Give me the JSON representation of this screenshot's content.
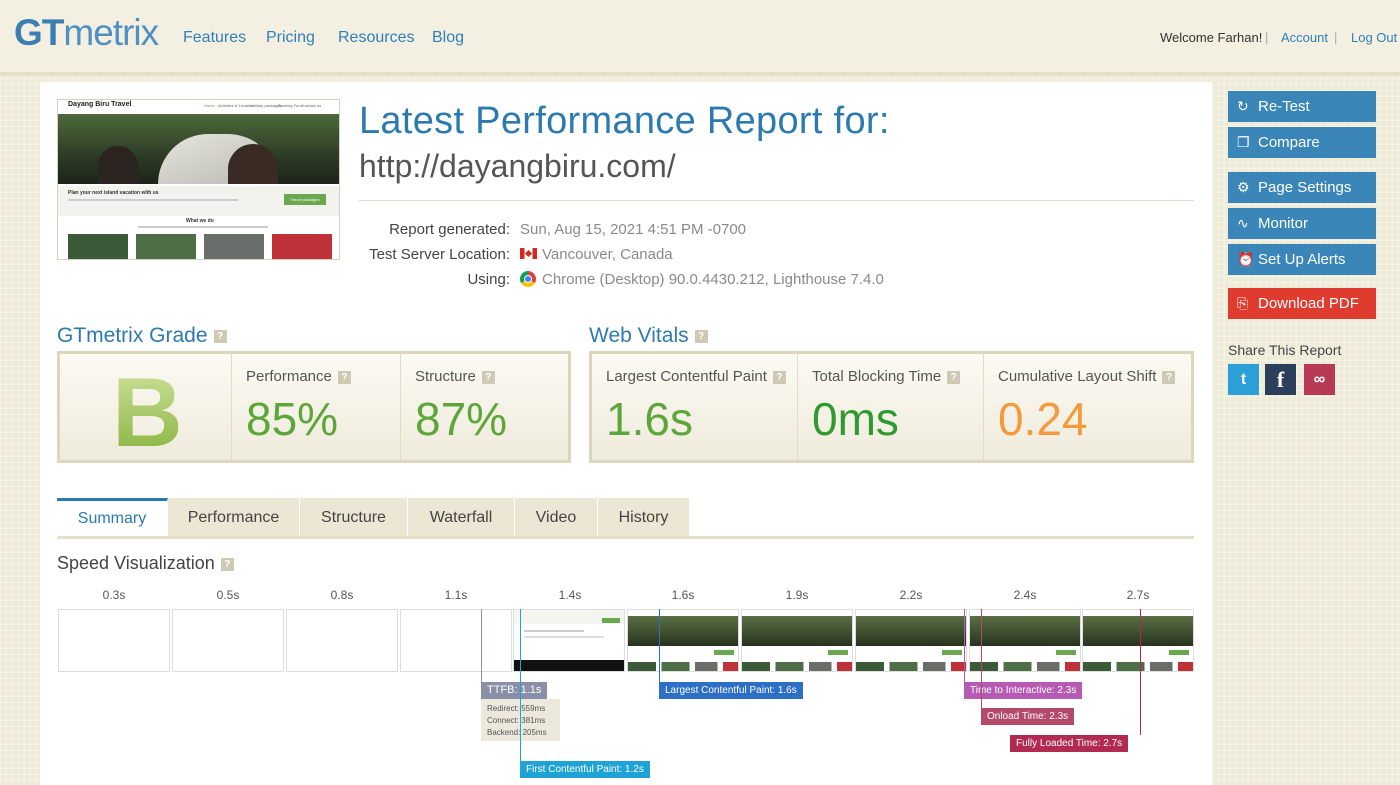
{
  "header": {
    "logo_gt": "GT",
    "logo_metrix": "metrix",
    "nav": [
      "Features",
      "Pricing",
      "Resources",
      "Blog"
    ],
    "welcome": "Welcome Farhan!",
    "account": "Account",
    "logout": "Log Out"
  },
  "report": {
    "title": "Latest Performance Report for:",
    "url": "http://dayangbiru.com/",
    "generated_label": "Report generated:",
    "generated_value": "Sun, Aug 15, 2021 4:51 PM -0700",
    "server_label": "Test Server Location:",
    "server_value": "Vancouver, Canada",
    "using_label": "Using:",
    "using_value": "Chrome (Desktop) 90.0.4430.212, Lighthouse 7.4.0"
  },
  "thumb": {
    "site_title": "Dayang Biru Travel",
    "menu": [
      "Home",
      "Activities & Location",
      "Holiday packages",
      "Booking Form",
      "Contact us"
    ],
    "banner": "Plan your next island vacation with us",
    "cta": "Travel packages",
    "what": "What we do"
  },
  "grade": {
    "title": "GTmetrix Grade",
    "letter": "B",
    "perf_label": "Performance",
    "perf_value": "85%",
    "struct_label": "Structure",
    "struct_value": "87%"
  },
  "vitals": {
    "title": "Web Vitals",
    "lcp_label": "Largest Contentful Paint",
    "lcp_value": "1.6s",
    "tbt_label": "Total Blocking Time",
    "tbt_value": "0ms",
    "cls_label": "Cumulative Layout Shift",
    "cls_value": "0.24"
  },
  "tabs": [
    "Summary",
    "Performance",
    "Structure",
    "Waterfall",
    "Video",
    "History"
  ],
  "speed": {
    "title": "Speed Visualization",
    "times": [
      "0.3s",
      "0.5s",
      "0.8s",
      "1.1s",
      "1.4s",
      "1.6s",
      "1.9s",
      "2.2s",
      "2.4s",
      "2.7s"
    ],
    "ttfb": "TTFB: 1.1s",
    "redirect": "Redirect: 559ms",
    "connect": "Connect: 381ms",
    "backend": "Backend: 205ms",
    "fcp": "First Contentful Paint: 1.2s",
    "lcp": "Largest Contentful Paint: 1.6s",
    "tti": "Time to Interactive: 2.3s",
    "onload": "Onload Time: 2.3s",
    "fully": "Fully Loaded Time: 2.7s"
  },
  "sidebar": {
    "retest": "Re-Test",
    "compare": "Compare",
    "settings": "Page Settings",
    "monitor": "Monitor",
    "alerts": "Set Up Alerts",
    "pdf": "Download PDF",
    "share": "Share This Report"
  },
  "colors": {
    "accent": "#2c7ab0",
    "grade": "#8fbe4a",
    "green": "#5ea63a",
    "orange": "#f39a3c",
    "pdf": "#e03b2f",
    "twitter": "#2a9fd8",
    "facebook": "#2c3f5a",
    "link": "#b73a55"
  }
}
